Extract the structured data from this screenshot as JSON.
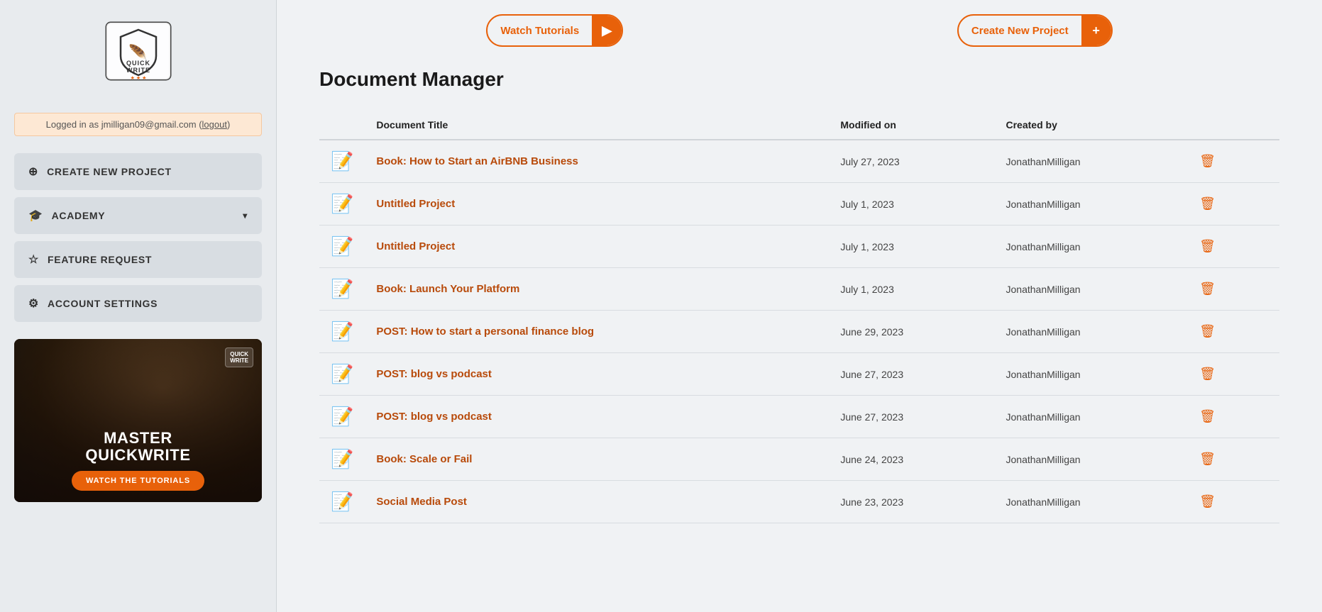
{
  "sidebar": {
    "logo_alt": "QuickWrite Logo",
    "login_text": "Logged in as jmilligan09@gmail.com",
    "login_link": "logout",
    "nav_items": [
      {
        "id": "create-new-project",
        "label": "CREATE NEW PROJECT",
        "icon": "⊕"
      },
      {
        "id": "academy",
        "label": "ACADEMY",
        "icon": "🎓",
        "has_chevron": true
      },
      {
        "id": "feature-request",
        "label": "FEATURE REQUEST",
        "icon": "☆"
      },
      {
        "id": "account-settings",
        "label": "ACCOUNT SETTINGS",
        "icon": "⚙"
      }
    ],
    "promo": {
      "title": "MASTER\nQUICKWRITE",
      "cta_label": "WATCH THE TUTORIALS",
      "badge_line1": "QUICK",
      "badge_line2": "WRITE"
    }
  },
  "topbar": {
    "watch_tutorials_label": "Watch Tutorials",
    "watch_tutorials_icon": "▶",
    "create_project_label": "Create New Project",
    "create_project_icon": "+"
  },
  "main": {
    "page_title": "Document Manager",
    "table_headers": {
      "col_icon": "",
      "col_title": "Document Title",
      "col_modified": "Modified on",
      "col_created_by": "Created by"
    },
    "documents": [
      {
        "id": 1,
        "title": "Book: How to Start an AirBNB Business",
        "modified": "July 27, 2023",
        "created_by": "JonathanMilligan"
      },
      {
        "id": 2,
        "title": "Untitled Project",
        "modified": "July 1, 2023",
        "created_by": "JonathanMilligan"
      },
      {
        "id": 3,
        "title": "Untitled Project",
        "modified": "July 1, 2023",
        "created_by": "JonathanMilligan"
      },
      {
        "id": 4,
        "title": "Book: Launch Your Platform",
        "modified": "July 1, 2023",
        "created_by": "JonathanMilligan"
      },
      {
        "id": 5,
        "title": "POST: How to start a personal finance blog",
        "modified": "June 29, 2023",
        "created_by": "JonathanMilligan"
      },
      {
        "id": 6,
        "title": "POST: blog vs podcast",
        "modified": "June 27, 2023",
        "created_by": "JonathanMilligan"
      },
      {
        "id": 7,
        "title": "POST: blog vs podcast",
        "modified": "June 27, 2023",
        "created_by": "JonathanMilligan"
      },
      {
        "id": 8,
        "title": "Book: Scale or Fail",
        "modified": "June 24, 2023",
        "created_by": "JonathanMilligan"
      },
      {
        "id": 9,
        "title": "Social Media Post",
        "modified": "June 23, 2023",
        "created_by": "JonathanMilligan"
      }
    ]
  }
}
